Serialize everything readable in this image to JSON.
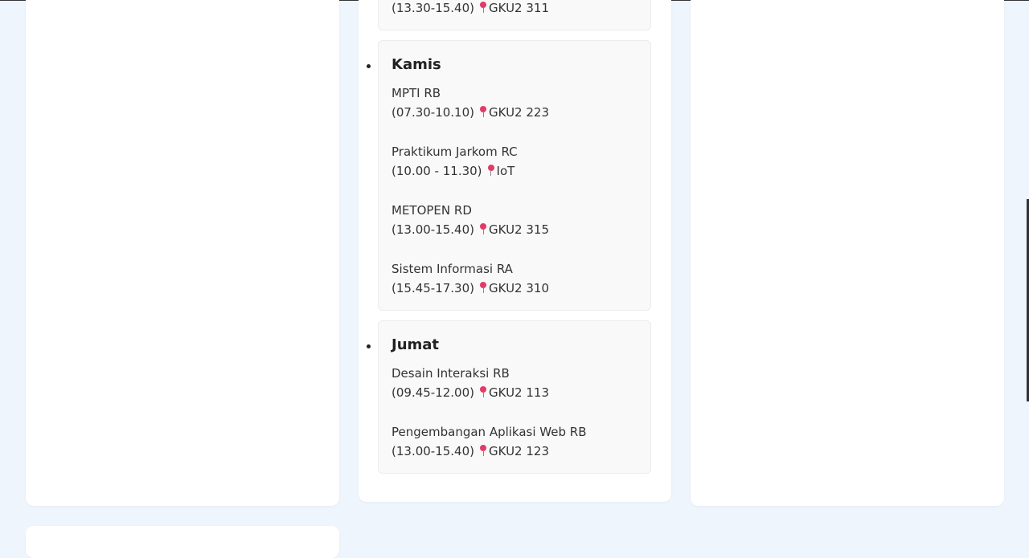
{
  "schedule": {
    "prev_tail": {
      "time": "(13.30-15.40)",
      "location": "GKU2 311"
    },
    "kamis": {
      "day": "Kamis",
      "entries": [
        {
          "course": "MPTI RB",
          "time": "(07.30-10.10)",
          "location": "GKU2 223"
        },
        {
          "course": "Praktikum Jarkom RC",
          "time": "(10.00 - 11.30)",
          "location": "IoT"
        },
        {
          "course": "METOPEN RD",
          "time": "(13.00-15.40)",
          "location": "GKU2 315"
        },
        {
          "course": "Sistem Informasi RA",
          "time": "(15.45-17.30)",
          "location": "GKU2 310"
        }
      ]
    },
    "jumat": {
      "day": "Jumat",
      "entries": [
        {
          "course": "Desain Interaksi RB",
          "time": "(09.45-12.00)",
          "location": "GKU2 113"
        },
        {
          "course": "Pengembangan Aplikasi Web RB",
          "time": "(13.00-15.40)",
          "location": "GKU2 123"
        }
      ]
    }
  },
  "colors": {
    "page_bg": "#eef5fc",
    "card_bg": "#ffffff",
    "day_box_bg": "#f9f9fa",
    "pin": "#e23b67"
  },
  "icons": {
    "location": "pushpin-icon"
  }
}
